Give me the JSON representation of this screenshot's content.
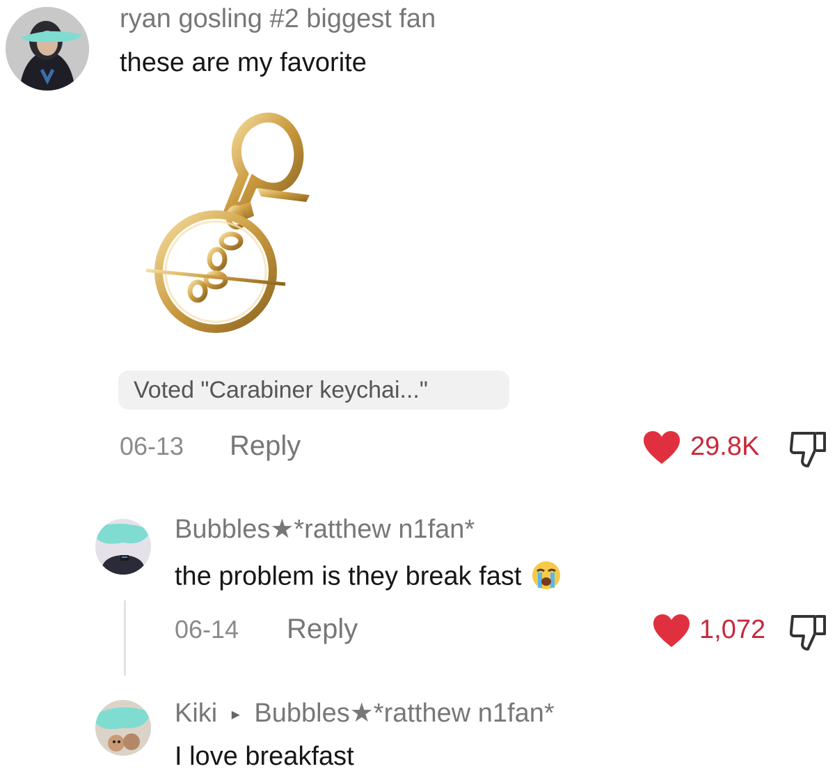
{
  "comments": [
    {
      "username": "ryan gosling #2 biggest fan",
      "text": "these are my favorite",
      "voted": "Voted \"Carabiner keychai...\"",
      "date": "06-13",
      "reply_label": "Reply",
      "likes": "29.8K"
    },
    {
      "username": "Bubbles★*ratthew n1fan*",
      "text": "the problem is they break fast",
      "emoji": "loudly-crying-face-emoji",
      "date": "06-14",
      "reply_label": "Reply",
      "likes": "1,072"
    },
    {
      "username": "Kiki",
      "reply_to_arrow": "▸",
      "reply_to": "Bubbles★*ratthew n1fan*",
      "text": "I love breakfast"
    }
  ],
  "colors": {
    "heart": "#e0303f",
    "likes_text": "#c8283a",
    "username": "#777777",
    "censor": "#7fdcd0"
  }
}
